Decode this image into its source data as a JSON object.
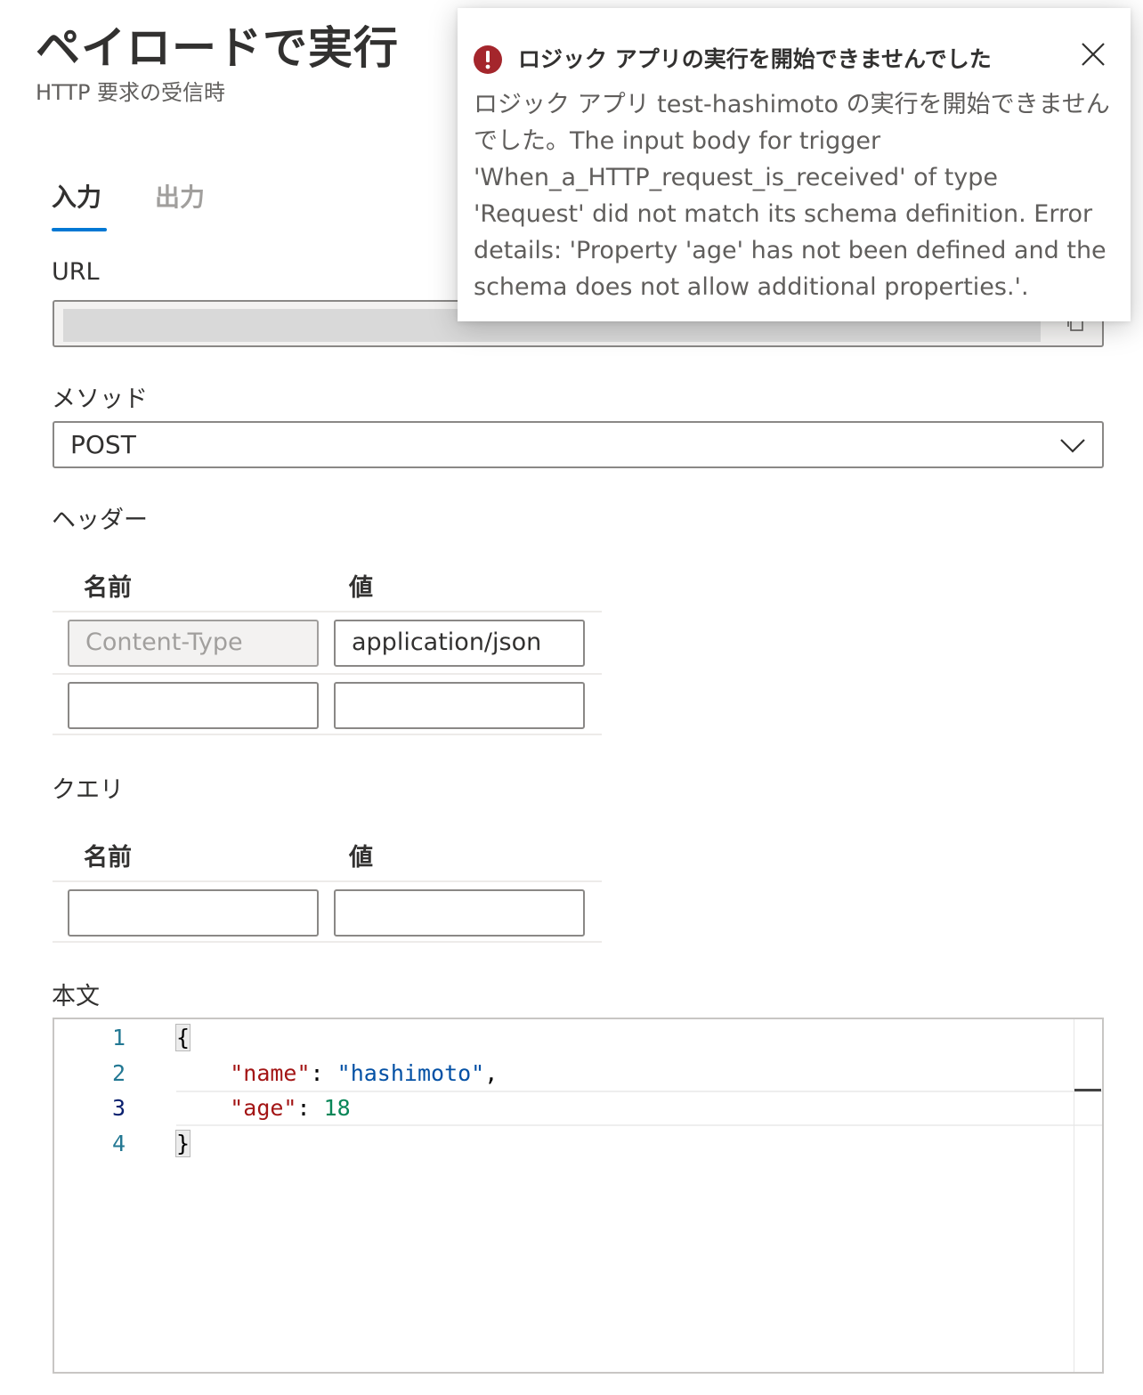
{
  "header": {
    "title": "ペイロードで実行",
    "subtitle": "HTTP 要求の受信時"
  },
  "tabs": [
    {
      "label": "入力",
      "active": true
    },
    {
      "label": "出力",
      "active": false
    }
  ],
  "url": {
    "label": "URL",
    "value": ""
  },
  "method": {
    "label": "メソッド",
    "value": "POST"
  },
  "headers_section": {
    "label": "ヘッダー",
    "name_col": "名前",
    "value_col": "値",
    "rows": [
      {
        "name": "Content-Type",
        "value": "application/json"
      },
      {
        "name": "",
        "value": ""
      }
    ]
  },
  "query_section": {
    "label": "クエリ",
    "name_col": "名前",
    "value_col": "値",
    "rows": [
      {
        "name": "",
        "value": ""
      }
    ]
  },
  "body_section": {
    "label": "本文",
    "line_numbers": [
      "1",
      "2",
      "3",
      "4"
    ],
    "code": {
      "open_brace": "{",
      "key1": "\"name\"",
      "colon": ":",
      "val1": "\"hashimoto\"",
      "comma": ",",
      "key2": "\"age\"",
      "val2": "18",
      "close_brace": "}"
    }
  },
  "toast": {
    "title": "ロジック アプリの実行を開始できませんでした",
    "message": "ロジック アプリ test-hashimoto の実行を開始できませんでした。The input body for trigger 'When_a_HTTP_request_is_received' of type 'Request' did not match its schema definition. Error details: 'Property 'age' has not been defined and the schema does not allow additional properties.'.",
    "error_color": "#a4262c"
  }
}
